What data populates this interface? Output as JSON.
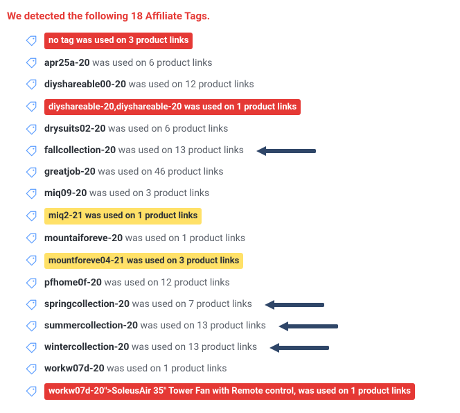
{
  "heading": "We detected the following 18 Affiliate Tags.",
  "rows": [
    {
      "style": "badge-red",
      "tag": "no tag",
      "suffix": " was used on 3 product links",
      "arrow": false
    },
    {
      "style": "plain",
      "tag": "apr25a-20",
      "suffix": " was used on 6 product links",
      "arrow": false
    },
    {
      "style": "plain",
      "tag": "diyshareable00-20",
      "suffix": " was used on 12 product links",
      "arrow": false
    },
    {
      "style": "badge-red",
      "tag": "diyshareable-20,diyshareable-20",
      "suffix": " was used on 1 product links",
      "arrow": false
    },
    {
      "style": "plain",
      "tag": "drysuits02-20",
      "suffix": " was used on 6 product links",
      "arrow": false
    },
    {
      "style": "plain",
      "tag": "fallcollection-20",
      "suffix": " was used on 13 product links",
      "arrow": true
    },
    {
      "style": "plain",
      "tag": "greatjob-20",
      "suffix": " was used on 46 product links",
      "arrow": false
    },
    {
      "style": "plain",
      "tag": "miq09-20",
      "suffix": " was used on 3 product links",
      "arrow": false
    },
    {
      "style": "badge-yellow",
      "tag": "miq2-21",
      "suffix": " was used on 1 product links",
      "arrow": false
    },
    {
      "style": "plain",
      "tag": "mountaiforeve-20",
      "suffix": " was used on 1 product links",
      "arrow": false
    },
    {
      "style": "badge-yellow",
      "tag": "mountforeve04-21",
      "suffix": " was used on 3 product links",
      "arrow": false
    },
    {
      "style": "plain",
      "tag": "pfhome0f-20",
      "suffix": " was used on 12 product links",
      "arrow": false
    },
    {
      "style": "plain",
      "tag": "springcollection-20",
      "suffix": " was used on 7 product links",
      "arrow": true
    },
    {
      "style": "plain",
      "tag": "summercollection-20",
      "suffix": " was used on 13 product links",
      "arrow": true
    },
    {
      "style": "plain",
      "tag": "wintercollection-20",
      "suffix": " was used on 13 product links",
      "arrow": true
    },
    {
      "style": "plain",
      "tag": "workw07d-20",
      "suffix": " was used on 1 product links",
      "arrow": false
    },
    {
      "style": "badge-red",
      "tag": "workw07d-20\">SoleusAir 35\" Tower Fan with Remote control,",
      "suffix": " was used on 1 product links",
      "arrow": false
    }
  ]
}
